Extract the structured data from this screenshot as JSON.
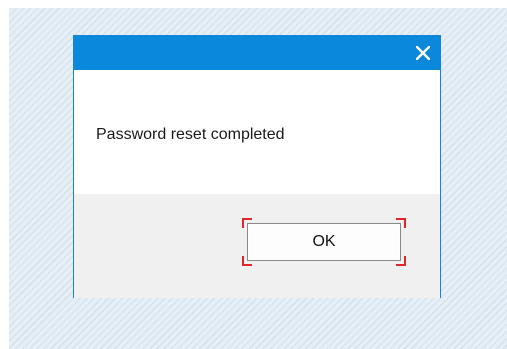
{
  "dialog": {
    "close_icon": "close-icon",
    "message": "Password reset completed",
    "ok_label": "OK"
  },
  "colors": {
    "titlebar": "#0a88dc",
    "dialog_border": "#1a82d4",
    "footer": "#f0f0f0",
    "focus_brackets": "#e0252b",
    "backdrop": "#e6eef6"
  }
}
